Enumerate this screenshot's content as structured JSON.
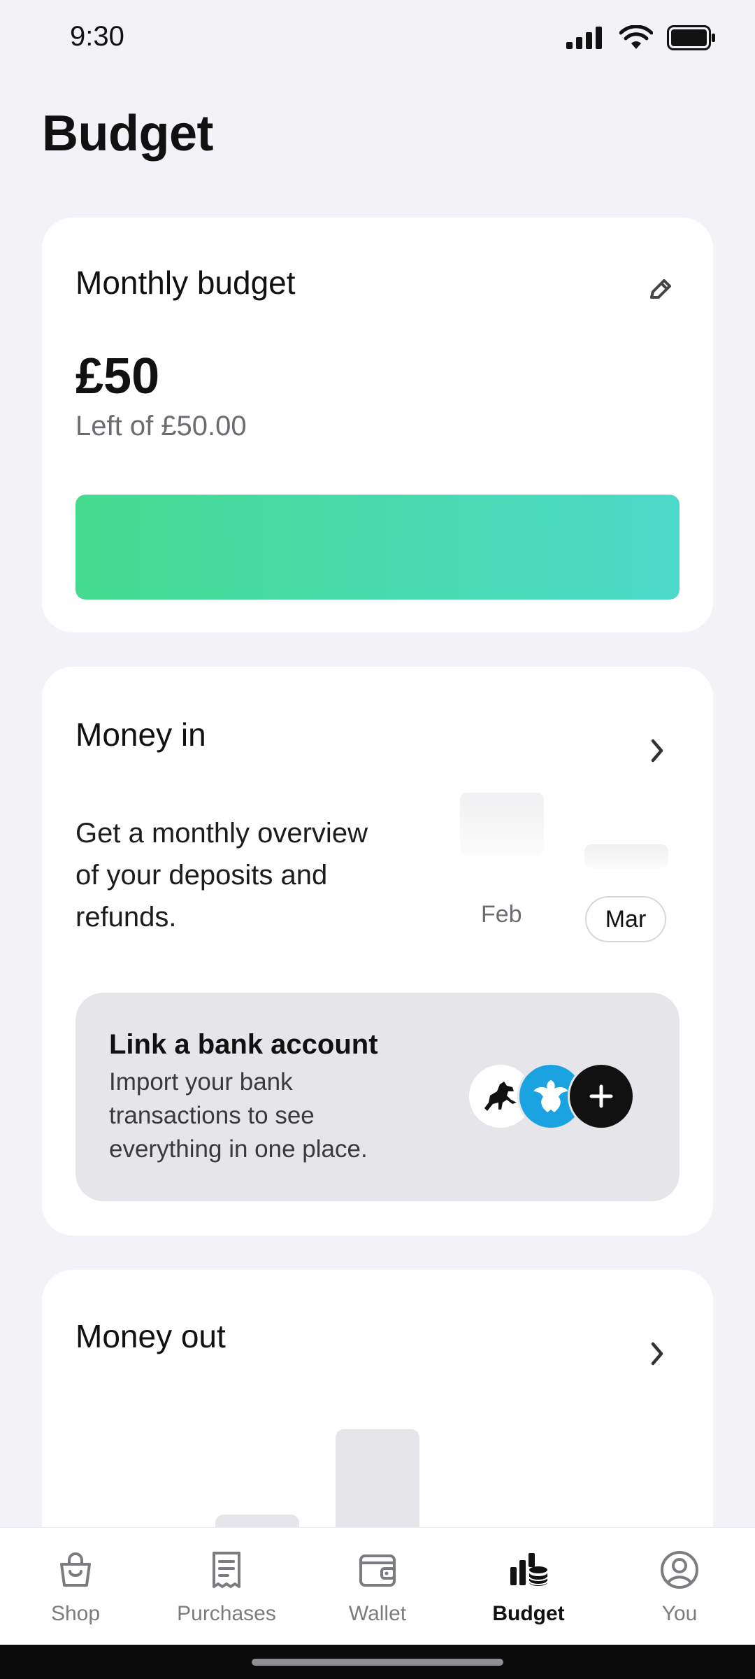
{
  "status": {
    "time": "9:30"
  },
  "header": {
    "title": "Budget"
  },
  "budget_card": {
    "title": "Monthly budget",
    "amount": "£50",
    "subtitle": "Left of £50.00",
    "remaining_fraction": 1.0,
    "gradient": [
      "#45db8f",
      "#4cd9c9"
    ]
  },
  "money_in": {
    "title": "Money in",
    "description": "Get a monthly overview of your deposits and refunds.",
    "months": [
      "Feb",
      "Mar"
    ],
    "selected_month": "Mar",
    "link_bank": {
      "title": "Link a bank account",
      "description": "Import your bank transactions to see everything in one place.",
      "icons": [
        "horse-logo-icon",
        "eagle-logo-icon",
        "plus-icon"
      ]
    }
  },
  "money_out": {
    "title": "Money out"
  },
  "tabs": [
    {
      "label": "Shop",
      "icon": "shopping-bag-icon",
      "active": false
    },
    {
      "label": "Purchases",
      "icon": "receipt-icon",
      "active": false
    },
    {
      "label": "Wallet",
      "icon": "wallet-icon",
      "active": false
    },
    {
      "label": "Budget",
      "icon": "budget-icon",
      "active": true
    },
    {
      "label": "You",
      "icon": "profile-icon",
      "active": false
    }
  ],
  "colors": {
    "background": "#f2f2f7",
    "accent_active": "#111111",
    "tab_inactive": "#7c7c80"
  }
}
